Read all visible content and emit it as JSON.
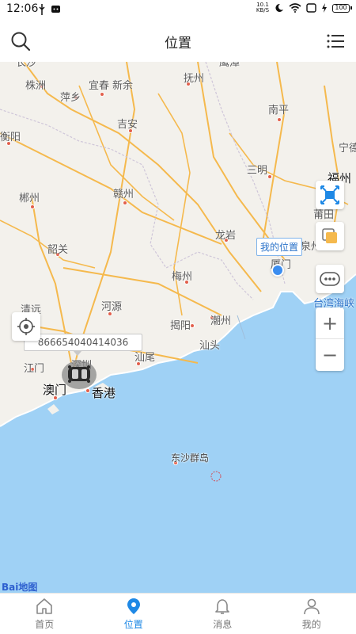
{
  "status_bar": {
    "time": "12:06",
    "net_speed_value": "10.1",
    "net_speed_unit": "KB/S",
    "battery": "100"
  },
  "header": {
    "title": "位置",
    "search_icon": "search-icon",
    "menu_icon": "list-menu-icon"
  },
  "map": {
    "places": {
      "changsha": "长沙",
      "zhuzhou": "株洲",
      "pingxiang": "萍乡",
      "yichun": "宜春",
      "xinyu": "新余",
      "fuzhou_jx": "抚州",
      "yingtan": "鹰潭",
      "hengyang": "衡阳",
      "ji_an": "吉安",
      "nanping": "南平",
      "ningde": "宁德",
      "sanming": "三明",
      "fuzhou": "福州",
      "chenzhou": "郴州",
      "ganzhou": "赣州",
      "putian": "莆田",
      "longyan": "龙岩",
      "quanzhou": "泉州",
      "xiamen": "厦门",
      "shaoguan": "韶关",
      "meizhou": "梅州",
      "qingyuan": "清远",
      "heyuan": "河源",
      "jieyang": "揭阳",
      "chaozhou": "潮州",
      "shantou": "汕头",
      "shanwei": "汕尾",
      "jiangmen": "江门",
      "shenzhen": "深圳",
      "macau": "澳门",
      "hongkong": "香港",
      "taiwan_strait": "台湾海峡",
      "dongsha": "东沙群岛"
    },
    "my_location_label": "我的位置",
    "device_id": "866654040414036",
    "baidu_logo_text": "Bai",
    "baidu_logo_suffix": "地图"
  },
  "controls": {
    "locate_icon": "crosshair-icon",
    "fit_icon": "fit-view-icon",
    "layers_icon": "layers-icon",
    "more_icon": "more-dots-icon",
    "zoom_in": "+",
    "zoom_out": "−"
  },
  "tabs": [
    {
      "label": "首页",
      "icon": "home-icon"
    },
    {
      "label": "位置",
      "icon": "location-pin-icon",
      "active": true
    },
    {
      "label": "消息",
      "icon": "bell-icon"
    },
    {
      "label": "我的",
      "icon": "user-icon"
    }
  ],
  "colors": {
    "accent": "#1e88e5",
    "land": "#f3f1ec",
    "sea": "#9fd1f5",
    "road": "#f5b94d",
    "my_location": "#3b8df0"
  }
}
